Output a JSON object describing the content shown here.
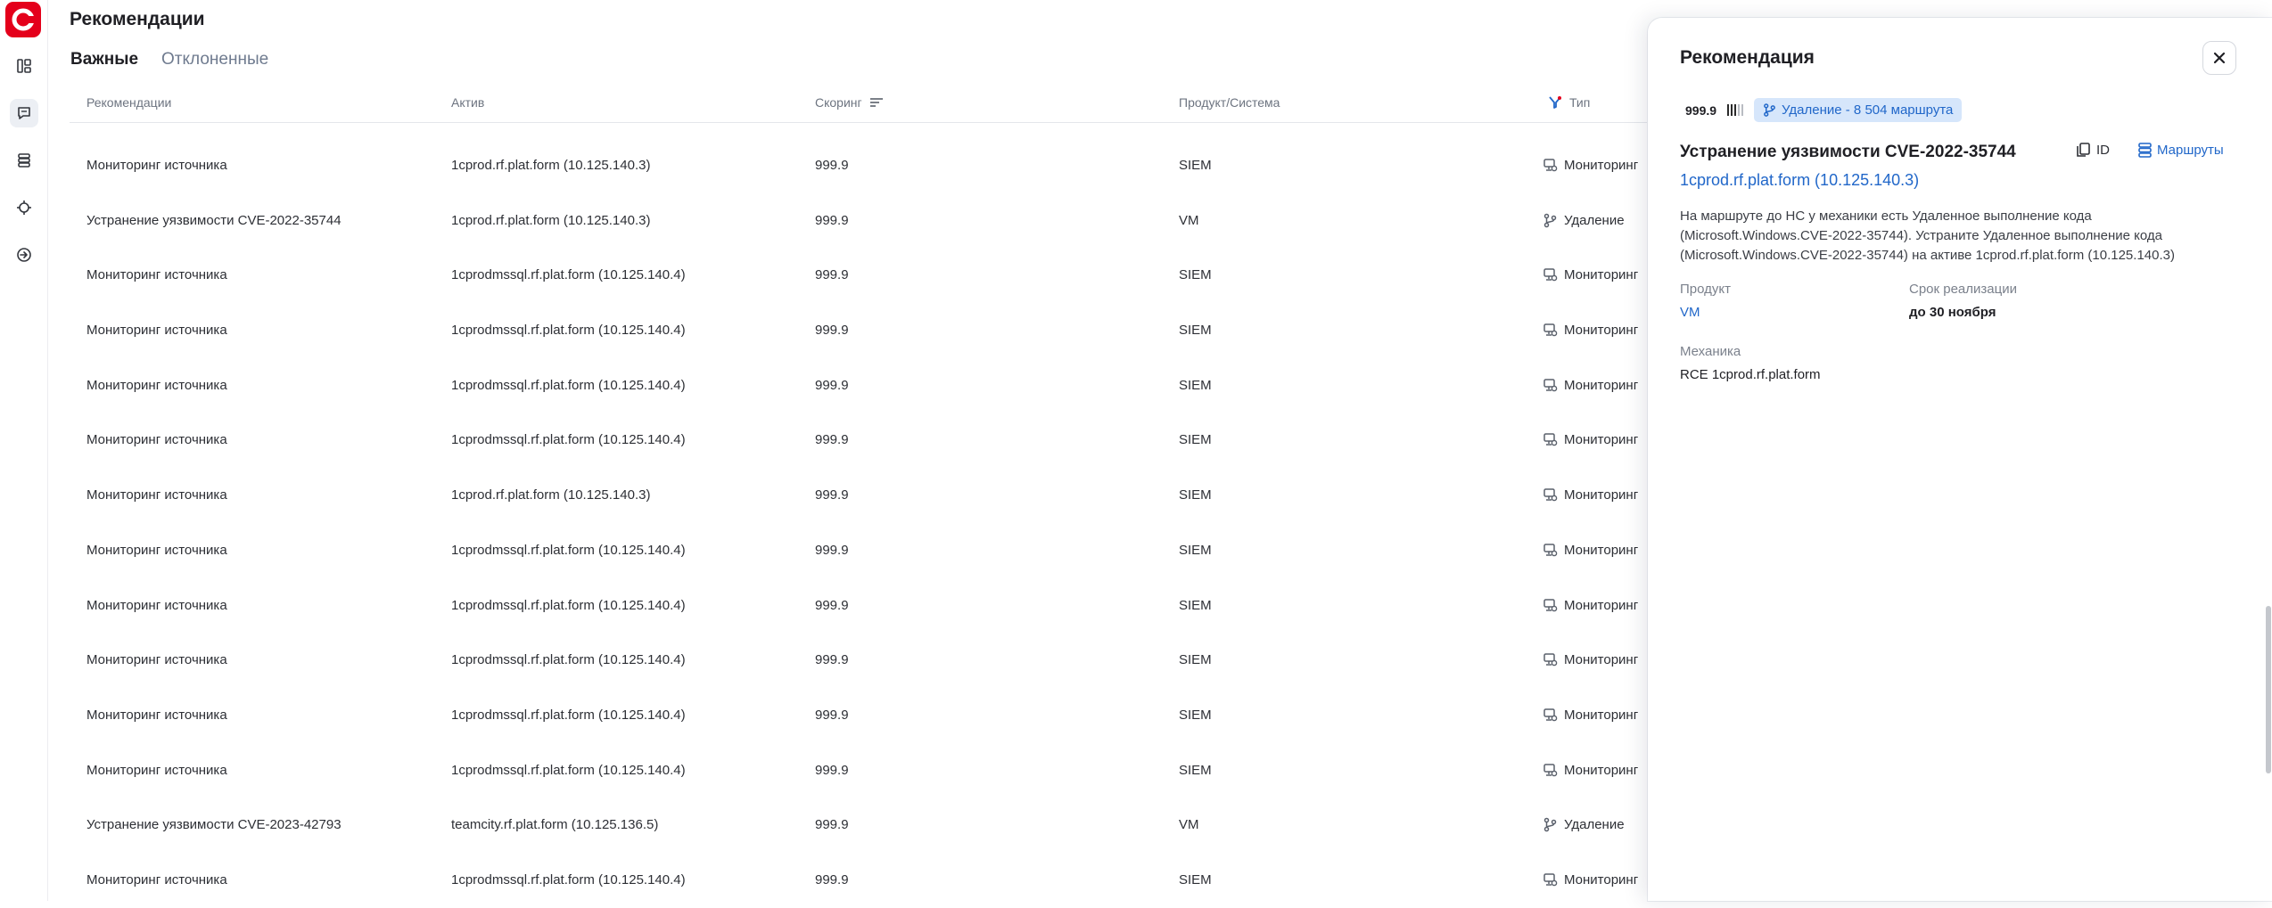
{
  "page": {
    "title": "Рекомендации"
  },
  "tabs": [
    {
      "label": "Важные",
      "active": true
    },
    {
      "label": "Отклоненные",
      "active": false
    }
  ],
  "table": {
    "headers": {
      "recommendation": "Рекомендации",
      "asset": "Актив",
      "score": "Скоринг",
      "product": "Продукт/Система",
      "type": "Тип"
    },
    "rows": [
      {
        "recommendation": "Мониторинг источника",
        "asset": "1cprod.rf.plat.form (10.125.140.3)",
        "score": "999.9",
        "product": "SIEM",
        "type": "Мониторинг",
        "type_icon": "monitor-icon"
      },
      {
        "recommendation": "Устранение уязвимости CVE-2022-35744",
        "asset": "1cprod.rf.plat.form (10.125.140.3)",
        "score": "999.9",
        "product": "VM",
        "type": "Удаление",
        "type_icon": "branch-icon"
      },
      {
        "recommendation": "Мониторинг источника",
        "asset": "1cprodmssql.rf.plat.form (10.125.140.4)",
        "score": "999.9",
        "product": "SIEM",
        "type": "Мониторинг",
        "type_icon": "monitor-icon"
      },
      {
        "recommendation": "Мониторинг источника",
        "asset": "1cprodmssql.rf.plat.form (10.125.140.4)",
        "score": "999.9",
        "product": "SIEM",
        "type": "Мониторинг",
        "type_icon": "monitor-icon"
      },
      {
        "recommendation": "Мониторинг источника",
        "asset": "1cprodmssql.rf.plat.form (10.125.140.4)",
        "score": "999.9",
        "product": "SIEM",
        "type": "Мониторинг",
        "type_icon": "monitor-icon"
      },
      {
        "recommendation": "Мониторинг источника",
        "asset": "1cprodmssql.rf.plat.form (10.125.140.4)",
        "score": "999.9",
        "product": "SIEM",
        "type": "Мониторинг",
        "type_icon": "monitor-icon"
      },
      {
        "recommendation": "Мониторинг источника",
        "asset": "1cprod.rf.plat.form (10.125.140.3)",
        "score": "999.9",
        "product": "SIEM",
        "type": "Мониторинг",
        "type_icon": "monitor-icon"
      },
      {
        "recommendation": "Мониторинг источника",
        "asset": "1cprodmssql.rf.plat.form (10.125.140.4)",
        "score": "999.9",
        "product": "SIEM",
        "type": "Мониторинг",
        "type_icon": "monitor-icon"
      },
      {
        "recommendation": "Мониторинг источника",
        "asset": "1cprodmssql.rf.plat.form (10.125.140.4)",
        "score": "999.9",
        "product": "SIEM",
        "type": "Мониторинг",
        "type_icon": "monitor-icon"
      },
      {
        "recommendation": "Мониторинг источника",
        "asset": "1cprodmssql.rf.plat.form (10.125.140.4)",
        "score": "999.9",
        "product": "SIEM",
        "type": "Мониторинг",
        "type_icon": "monitor-icon"
      },
      {
        "recommendation": "Мониторинг источника",
        "asset": "1cprodmssql.rf.plat.form (10.125.140.4)",
        "score": "999.9",
        "product": "SIEM",
        "type": "Мониторинг",
        "type_icon": "monitor-icon"
      },
      {
        "recommendation": "Мониторинг источника",
        "asset": "1cprodmssql.rf.plat.form (10.125.140.4)",
        "score": "999.9",
        "product": "SIEM",
        "type": "Мониторинг",
        "type_icon": "monitor-icon"
      },
      {
        "recommendation": "Устранение уязвимости CVE-2023-42793",
        "asset": "teamcity.rf.plat.form (10.125.136.5)",
        "score": "999.9",
        "product": "VM",
        "type": "Удаление",
        "type_icon": "branch-icon"
      },
      {
        "recommendation": "Мониторинг источника",
        "asset": "1cprodmssql.rf.plat.form (10.125.140.4)",
        "score": "999.9",
        "product": "SIEM",
        "type": "Мониторинг",
        "type_icon": "monitor-icon"
      }
    ]
  },
  "panel": {
    "title": "Рекомендация",
    "score": "999.9",
    "score_level": 0.6,
    "badge": "Удаление - 8 504 маршрута",
    "rec_title": "Устранение уязвимости CVE-2022-35744",
    "id_label": "ID",
    "routes_label": "Маршруты",
    "asset": "1cprod.rf.plat.form (10.125.140.3)",
    "description_line1": "На маршруте до НС у механики есть Удаленное выполнение кода",
    "description_line2": "(Microsoft.Windows.CVE-2022-35744). Устраните Удаленное выполнение кода",
    "description_line3": "(Microsoft.Windows.CVE-2022-35744) на активе 1cprod.rf.plat.form (10.125.140.3)",
    "product_label": "Продукт",
    "product_value": "VM",
    "deadline_label": "Срок реализации",
    "deadline_value": "до 30 ноября",
    "mechanics_label": "Механика",
    "mechanics_value": "RCE 1cprod.rf.plat.form"
  },
  "colors": {
    "brand": "#e4001b",
    "link": "#2167c9",
    "badge_bg": "#d6e6fb",
    "muted_text": "#6d7480"
  },
  "icons": {
    "rail": [
      "dashboard-icon",
      "chat-icon",
      "storage-icon",
      "target-icon",
      "login-icon"
    ],
    "close": "close-icon",
    "copy": "copy-icon",
    "routes": "routes-icon",
    "sort": "sort-icon",
    "filter": "filter-icon"
  }
}
